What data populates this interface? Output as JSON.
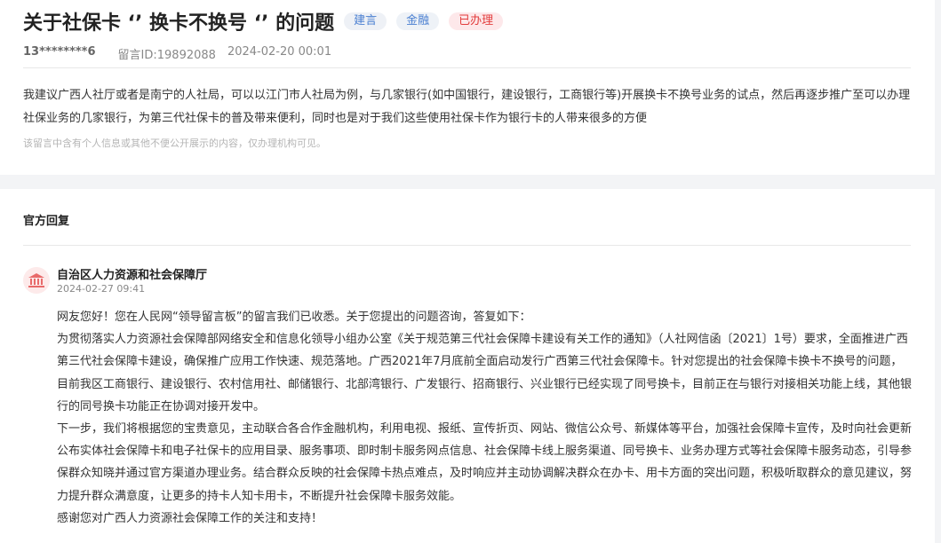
{
  "message": {
    "title": "关于社保卡 ‘’ 换卡不换号 ‘’ 的问题",
    "tags": [
      "建言",
      "金融",
      "已办理"
    ],
    "user": "13********6",
    "message_id": "留言ID:19892088",
    "date": "2024-02-20 00:01",
    "content": "我建议广西人社厅或者是南宁的人社局，可以以江门市人社局为例，与几家银行(如中国银行，建设银行，工商银行等)开展换卡不换号业务的试点，然后再逐步推广至可以办理社保业务的几家银行，为第三代社保卡的普及带来便利，同时也是对于我们这些使用社保卡作为银行卡的人带来很多的方便",
    "privacy_notice": "该留言中含有个人信息或其他不便公开展示的内容，仅办理机构可见。"
  },
  "reply": {
    "section_title": "官方回复",
    "org_name": "自治区人力资源和社会保障厅",
    "date": "2024-02-27 09:41",
    "paragraphs": [
      "网友您好！您在人民网“领导留言板”的留言我们已收悉。关于您提出的问题咨询，答复如下：",
      "为贯彻落实人力资源社会保障部网络安全和信息化领导小组办公室《关于规范第三代社会保障卡建设有关工作的通知》（人社网信函〔2021〕1号）要求，全面推进广西第三代社会保障卡建设，确保推广应用工作快速、规范落地。广西2021年7月底前全面启动发行广西第三代社会保障卡。针对您提出的社会保障卡换卡不换号的问题，目前我区工商银行、建设银行、农村信用社、邮储银行、北部湾银行、广发银行、招商银行、兴业银行已经实现了同号换卡，目前正在与银行对接相关功能上线，其他银行的同号换卡功能正在协调对接开发中。",
      "下一步，我们将根据您的宝贵意见，主动联合各合作金融机构，利用电视、报纸、宣传折页、网站、微信公众号、新媒体等平台，加强社会保障卡宣传，及时向社会更新公布实体社会保障卡和电子社保卡的应用目录、服务事项、即时制卡服务网点信息、社会保障卡线上服务渠道、同号换卡、业务办理方式等社会保障卡服务动态，引导参保群众知晓并通过官方渠道办理业务。结合群众反映的社会保障卡热点难点，及时响应并主动协调解决群众在办卡、用卡方面的突出问题，积极听取群众的意见建议，努力提升群众满意度，让更多的持卡人知卡用卡，不断提升社会保障卡服务效能。",
      "感谢您对广西人力资源社会保障工作的关注和支持！"
    ],
    "avatar_icon": "government-building-icon"
  },
  "colors": {
    "tag_blue": "#4a7fd1",
    "tag_red": "#e23d3d",
    "avatar_bg": "#fdeaea",
    "avatar_fg": "#e86a6a"
  }
}
